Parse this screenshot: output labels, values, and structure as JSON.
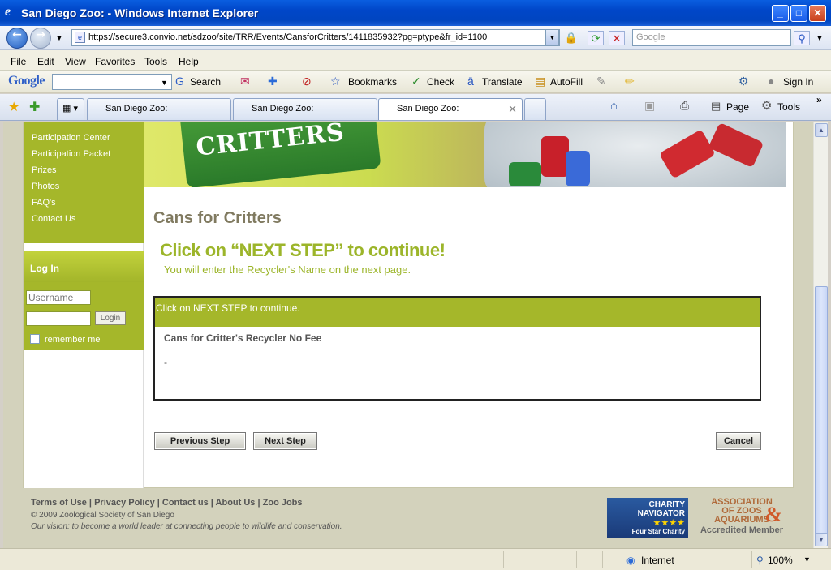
{
  "window": {
    "title": "San Diego Zoo: - Windows Internet Explorer"
  },
  "address": {
    "url": "https://secure3.convio.net/sdzoo/site/TRR/Events/CansforCritters/1411835932?pg=ptype&fr_id=1100",
    "search_placeholder": "Google"
  },
  "menu": [
    "File",
    "Edit",
    "View",
    "Favorites",
    "Tools",
    "Help"
  ],
  "google_toolbar": {
    "logo": "Google",
    "search": "Search",
    "bookmarks": "Bookmarks",
    "check": "Check",
    "translate": "Translate",
    "autofill": "AutoFill",
    "sign_in": "Sign In"
  },
  "tabs": [
    "San Diego Zoo:",
    "San Diego Zoo:",
    "San Diego Zoo:"
  ],
  "command_bar": {
    "page": "Page",
    "tools": "Tools"
  },
  "sidebar": {
    "nav": [
      "Participation Center",
      "Participation Packet",
      "Prizes",
      "Photos",
      "FAQ's",
      "Contact Us"
    ],
    "login_heading": "Log In",
    "username_placeholder": "Username",
    "login_button": "Login",
    "remember_me": "remember me"
  },
  "banner": {
    "can_text": "CRITTERS"
  },
  "main": {
    "title": "Cans for Critters",
    "cta": "Click on “NEXT STEP” to continue!",
    "sub": "You will enter the Recycler's Name on the next page.",
    "box_header": "Click on NEXT STEP to continue.",
    "item": "Cans for Critter's Recycler  No Fee",
    "dash": "-",
    "prev_button": "Previous Step",
    "next_button": "Next Step",
    "cancel_button": "Cancel"
  },
  "footer": {
    "links": [
      "Terms of Use",
      "Privacy Policy",
      "Contact us",
      "About Us",
      "Zoo Jobs"
    ],
    "copyright": "© 2009 Zoological Society of San Diego",
    "vision": "Our vision: to become a world leader at connecting people to wildlife and conservation.",
    "charity_line1": "CHARITY",
    "charity_line2": "NAVIGATOR",
    "charity_stars": "★★★★",
    "charity_line3": "Four Star Charity",
    "aza_line1": "ASSOCIATION",
    "aza_line2": "OF ZOOS",
    "aza_line3": "AQUARIUMS",
    "aza_accredited": "Accredited Member"
  },
  "status": {
    "zone": "Internet",
    "zoom": "100%"
  }
}
